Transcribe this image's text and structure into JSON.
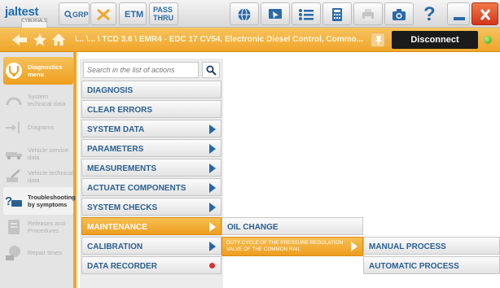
{
  "toolbar": {
    "logo_text": "jaltest",
    "logo_sub": "CYBERNALS",
    "grp_label": "GRP",
    "etm_label": "ETM",
    "pass_thru_label": "PASS THRU"
  },
  "navbar": {
    "breadcrumb": "\\... \\... \\ TCD 3.6 \\ EMR4 - EDC 17 CV54, Electronic Diesel Control, Commo...",
    "disconnect_label": "Disconnect",
    "connection_color": "#3f9a15"
  },
  "sidebar": {
    "items": [
      {
        "label": "Diagnostics menu",
        "icon": "stethoscope-icon"
      },
      {
        "label": "System technical data",
        "icon": "gauge-icon"
      },
      {
        "label": "Diagrams",
        "icon": "diagram-icon"
      },
      {
        "label": "Vehicle service data",
        "icon": "truck-icon"
      },
      {
        "label": "Vehicle technical data",
        "icon": "wrench-icon"
      },
      {
        "label": "Troubleshooting by symptoms",
        "icon": "troubleshooting-icon"
      },
      {
        "label": "Releases and Procedures",
        "icon": "document-icon"
      },
      {
        "label": "Repair times",
        "icon": "clock-icon"
      }
    ]
  },
  "search": {
    "placeholder": "Search in the list of actions"
  },
  "actions": [
    {
      "label": "DIAGNOSIS"
    },
    {
      "label": "CLEAR ERRORS"
    },
    {
      "label": "SYSTEM DATA"
    },
    {
      "label": "PARAMETERS"
    },
    {
      "label": "MEASUREMENTS"
    },
    {
      "label": "ACTUATE COMPONENTS"
    },
    {
      "label": "SYSTEM CHECKS"
    },
    {
      "label": "MAINTENANCE"
    },
    {
      "label": "CALIBRATION"
    },
    {
      "label": "DATA RECORDER"
    }
  ],
  "submenu_maintenance": [
    {
      "label": "OIL CHANGE"
    },
    {
      "label": "DUTY CYCLE OF THE PRESSURE REGULATION VALVE OF THE COMMON RAIL"
    }
  ],
  "submenu_duty_cycle": [
    {
      "label": "MANUAL PROCESS"
    },
    {
      "label": "AUTOMATIC PROCESS"
    }
  ],
  "colors": {
    "accent": "#f0a629",
    "link_blue": "#2a5f8f",
    "window_close": "#e04a2a"
  }
}
